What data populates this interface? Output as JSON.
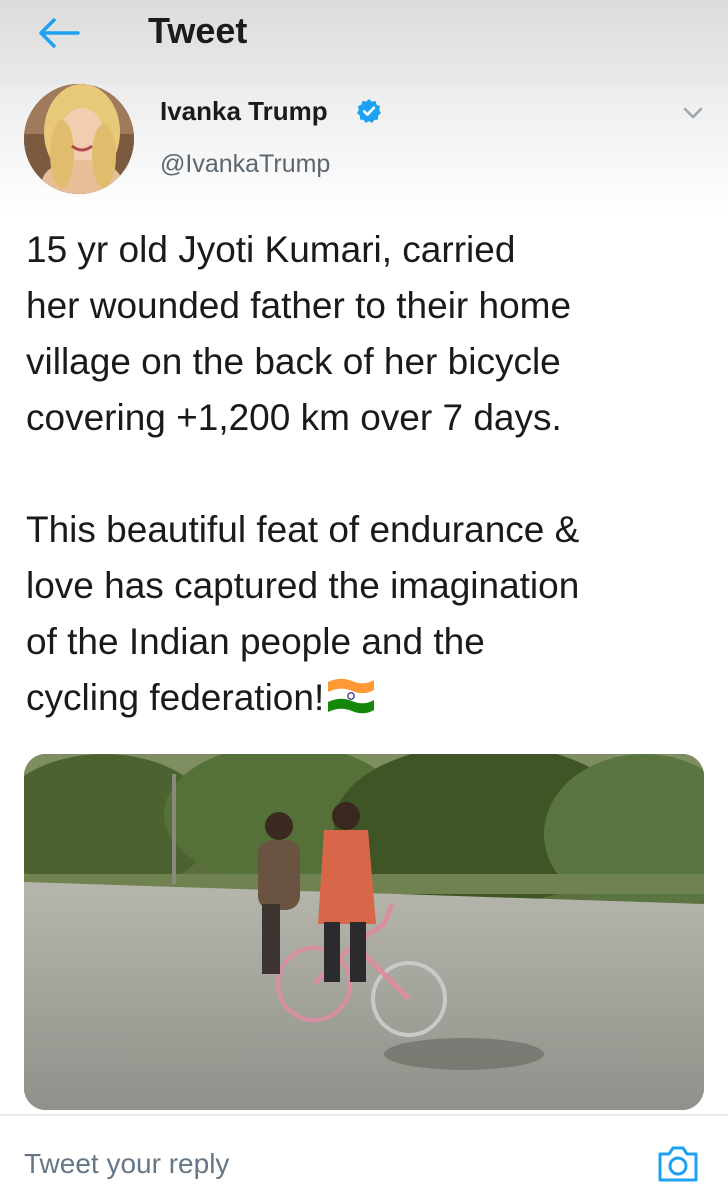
{
  "header": {
    "title": "Tweet",
    "back_icon": "back-arrow-icon"
  },
  "tweet": {
    "author_name": "Ivanka Trump",
    "handle": "@IvankaTrump",
    "verified": true,
    "paragraphs": [
      "15 yr old Jyoti Kumari, carried\nher wounded father to their home\nvillage on the back of her bicycle\ncovering +1,200 km over 7 days.",
      "This beautiful feat of endurance &\nlove has captured the imagination\nof the Indian people and the\ncycling federation!"
    ],
    "emoji": "india-flag-emoji",
    "media": "photo of a girl riding a pink bicycle carrying a man on the back seat along a road"
  },
  "reply": {
    "placeholder": "Tweet your reply",
    "camera_icon": "camera-icon"
  },
  "colors": {
    "accent": "#1da1f2",
    "header_bg": "#e1e1e1",
    "text": "#14171a",
    "secondary_text": "#657786"
  }
}
